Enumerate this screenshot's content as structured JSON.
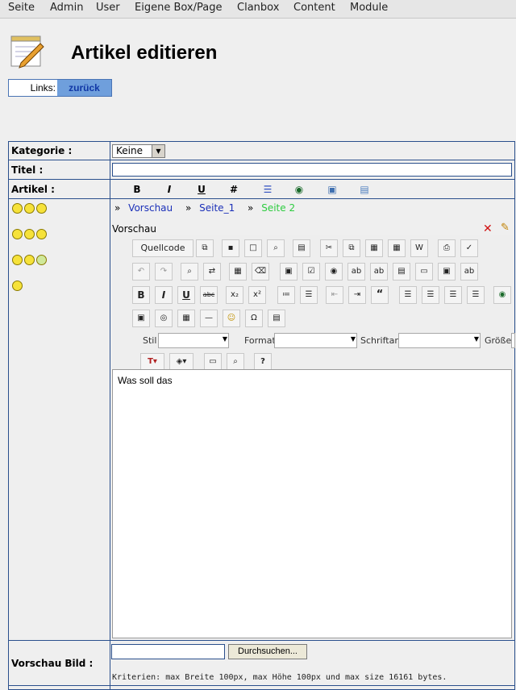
{
  "menu": [
    "Seite",
    "Admin",
    "User",
    "Eigene Box/Page",
    "Clanbox",
    "Content",
    "Module"
  ],
  "page": {
    "title": "Artikel editieren"
  },
  "links": {
    "label": "Links:",
    "back": "zurück"
  },
  "form": {
    "kategorie_label": "Kategorie :",
    "kategorie_value": "Keine",
    "titel_label": "Titel :",
    "artikel_label": "Artikel :",
    "format_buttons": [
      "B",
      "I",
      "U",
      "#",
      "list-icon",
      "globe-icon",
      "image-icon",
      "page-icon"
    ],
    "tabs": [
      {
        "label": "Vorschau",
        "color": "#1a2fb8"
      },
      {
        "label": "Seite_1",
        "color": "#1a2fb8"
      },
      {
        "label": "Seite 2",
        "color": "#2ecc40"
      }
    ],
    "tab_prefix": "»",
    "vorschau_label": "Vorschau",
    "editor": {
      "quellcode": "Quellcode",
      "stil": "Stil",
      "format": "Format",
      "schriftart": "Schriftart",
      "groesse": "Größe",
      "content": "Was soll das"
    },
    "vorschau_bild_label": "Vorschau Bild :",
    "browse_button": "Durchsuchen...",
    "criteria": "Kriterien: max Breite 100px, max Höhe 100px und max size 16161 bytes."
  },
  "colors": {
    "border": "#2a4f8c",
    "back_button": "#6f9fdc",
    "active_tab": "#2ecc40"
  }
}
